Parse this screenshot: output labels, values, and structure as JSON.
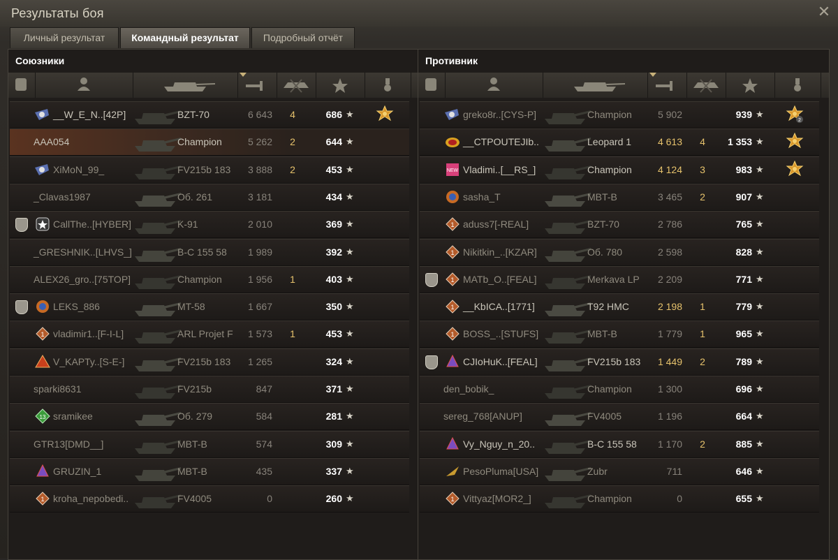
{
  "window": {
    "title": "Результаты боя",
    "close_icon": "close-icon"
  },
  "tabs": [
    {
      "label": "Личный результат",
      "active": false
    },
    {
      "label": "Командный результат",
      "active": true
    },
    {
      "label": "Подробный отчёт",
      "active": false
    }
  ],
  "columns": [
    "platoon-icon",
    "player-icon",
    "tank-icon",
    "damage-icon",
    "kills-icon",
    "xp-star-icon",
    "medal-icon"
  ],
  "allies": {
    "title": "Союзники",
    "rows": [
      {
        "name": "__W_E_N..[42P]",
        "vehicle": "BZT-70",
        "damage": "6 643",
        "kills": "4",
        "xp": "686",
        "badge": "rank",
        "medal": "ace",
        "platoon": false,
        "alive": true,
        "dmg_hi": false,
        "player": false
      },
      {
        "name": "AAA054",
        "vehicle": "Champion",
        "damage": "5 262",
        "kills": "2",
        "xp": "644",
        "badge": "",
        "medal": "",
        "platoon": false,
        "alive": false,
        "dmg_hi": false,
        "player": true
      },
      {
        "name": "XiMoN_99_",
        "vehicle": "FV215b 183",
        "damage": "3 888",
        "kills": "2",
        "xp": "453",
        "badge": "rank",
        "medal": "",
        "platoon": false,
        "alive": false,
        "dmg_hi": false,
        "player": false
      },
      {
        "name": "_Clavas1987",
        "vehicle": "Об. 261",
        "damage": "3 181",
        "kills": "",
        "xp": "434",
        "badge": "",
        "medal": "",
        "platoon": false,
        "alive": false,
        "dmg_hi": false,
        "player": false
      },
      {
        "name": "CallThe..[HYBER]",
        "vehicle": "K-91",
        "damage": "2 010",
        "kills": "",
        "xp": "369",
        "badge": "star",
        "medal": "",
        "platoon": true,
        "alive": false,
        "dmg_hi": false,
        "player": false
      },
      {
        "name": "_GRESHNIK..[LHVS_]",
        "vehicle": "В-С 155 58",
        "damage": "1 989",
        "kills": "",
        "xp": "392",
        "badge": "",
        "medal": "",
        "platoon": false,
        "alive": false,
        "dmg_hi": false,
        "player": false
      },
      {
        "name": "ALEX26_gro..[75TOP]",
        "vehicle": "Champion",
        "damage": "1 956",
        "kills": "1",
        "xp": "403",
        "badge": "",
        "medal": "",
        "platoon": false,
        "alive": false,
        "dmg_hi": false,
        "player": false
      },
      {
        "name": "LEKS_886",
        "vehicle": "MT-58",
        "damage": "1 667",
        "kills": "",
        "xp": "350",
        "badge": "gold",
        "medal": "",
        "platoon": true,
        "alive": false,
        "dmg_hi": false,
        "player": false
      },
      {
        "name": "vladimir1..[F-I-L]",
        "vehicle": "ARL Projet F",
        "damage": "1 573",
        "kills": "1",
        "xp": "453",
        "badge": "diamond",
        "medal": "",
        "platoon": false,
        "alive": false,
        "dmg_hi": false,
        "player": false
      },
      {
        "name": "V_KAPTy..[S-E-]",
        "vehicle": "FV215b 183",
        "damage": "1 265",
        "kills": "",
        "xp": "324",
        "badge": "triangle",
        "medal": "",
        "platoon": false,
        "alive": false,
        "dmg_hi": false,
        "player": false
      },
      {
        "name": "sparki8631",
        "vehicle": "FV215b",
        "damage": "847",
        "kills": "",
        "xp": "371",
        "badge": "",
        "medal": "",
        "platoon": false,
        "alive": false,
        "dmg_hi": false,
        "player": false
      },
      {
        "name": "sramikee",
        "vehicle": "Об. 279",
        "damage": "584",
        "kills": "",
        "xp": "281",
        "badge": "green",
        "medal": "",
        "platoon": false,
        "alive": false,
        "dmg_hi": false,
        "player": false
      },
      {
        "name": "GTR13[DMD__]",
        "vehicle": "MBT-B",
        "damage": "574",
        "kills": "",
        "xp": "309",
        "badge": "",
        "medal": "",
        "platoon": false,
        "alive": false,
        "dmg_hi": false,
        "player": false
      },
      {
        "name": "GRUZIN_1",
        "vehicle": "MBT-B",
        "damage": "435",
        "kills": "",
        "xp": "337",
        "badge": "purple",
        "medal": "",
        "platoon": false,
        "alive": false,
        "dmg_hi": false,
        "player": false
      },
      {
        "name": "kroha_nepobedi..",
        "vehicle": "FV4005",
        "damage": "0",
        "kills": "",
        "xp": "260",
        "badge": "diamond",
        "medal": "",
        "platoon": false,
        "alive": false,
        "dmg_hi": false,
        "player": false
      }
    ]
  },
  "enemies": {
    "title": "Противник",
    "rows": [
      {
        "name": "greko8r..[CYS-P]",
        "vehicle": "Champion",
        "damage": "5 902",
        "kills": "",
        "xp": "939",
        "badge": "rank",
        "medal": "ace2",
        "platoon": false,
        "alive": false,
        "dmg_hi": false,
        "player": false
      },
      {
        "name": "__CTPOUTEJIb..",
        "vehicle": "Leopard 1",
        "damage": "4 613",
        "kills": "4",
        "xp": "1 353",
        "badge": "gold-red",
        "medal": "ace",
        "platoon": false,
        "alive": true,
        "dmg_hi": true,
        "player": false
      },
      {
        "name": "Vladimi..[__RS_]",
        "vehicle": "Champion",
        "damage": "4 124",
        "kills": "3",
        "xp": "983",
        "badge": "pink",
        "medal": "ace",
        "platoon": false,
        "alive": true,
        "dmg_hi": true,
        "player": false
      },
      {
        "name": "sasha_T",
        "vehicle": "MBT-B",
        "damage": "3 465",
        "kills": "2",
        "xp": "907",
        "badge": "gold",
        "medal": "",
        "platoon": false,
        "alive": false,
        "dmg_hi": false,
        "player": false
      },
      {
        "name": "aduss7[-REAL]",
        "vehicle": "BZT-70",
        "damage": "2 786",
        "kills": "",
        "xp": "765",
        "badge": "diamond",
        "medal": "",
        "platoon": false,
        "alive": false,
        "dmg_hi": false,
        "player": false
      },
      {
        "name": "Nikitkin_..[KZAR]",
        "vehicle": "Об. 780",
        "damage": "2 598",
        "kills": "",
        "xp": "828",
        "badge": "diamond",
        "medal": "",
        "platoon": false,
        "alive": false,
        "dmg_hi": false,
        "player": false
      },
      {
        "name": "MATb_O..[FEAL]",
        "vehicle": "Merkava LP",
        "damage": "2 209",
        "kills": "",
        "xp": "771",
        "badge": "diamond",
        "medal": "",
        "platoon": true,
        "alive": false,
        "dmg_hi": false,
        "player": false
      },
      {
        "name": "__KbICA..[1771]",
        "vehicle": "T92 HMC",
        "damage": "2 198",
        "kills": "1",
        "xp": "779",
        "badge": "diamond",
        "medal": "",
        "platoon": false,
        "alive": true,
        "dmg_hi": true,
        "player": false
      },
      {
        "name": "BOSS_..[STUFS]",
        "vehicle": "MBT-B",
        "damage": "1 779",
        "kills": "1",
        "xp": "965",
        "badge": "diamond",
        "medal": "",
        "platoon": false,
        "alive": false,
        "dmg_hi": false,
        "player": false
      },
      {
        "name": "CJIoHuK..[FEAL]",
        "vehicle": "FV215b 183",
        "damage": "1 449",
        "kills": "2",
        "xp": "789",
        "badge": "purple",
        "medal": "",
        "platoon": true,
        "alive": true,
        "dmg_hi": true,
        "player": false
      },
      {
        "name": "den_bobik_",
        "vehicle": "Champion",
        "damage": "1 300",
        "kills": "",
        "xp": "696",
        "badge": "",
        "medal": "",
        "platoon": false,
        "alive": false,
        "dmg_hi": false,
        "player": false
      },
      {
        "name": "sereg_768[ANUP]",
        "vehicle": "FV4005",
        "damage": "1 196",
        "kills": "",
        "xp": "664",
        "badge": "",
        "medal": "",
        "platoon": false,
        "alive": false,
        "dmg_hi": false,
        "player": false
      },
      {
        "name": "Vy_Nguy_n_20..",
        "vehicle": "В-С 155 58",
        "damage": "1 170",
        "kills": "2",
        "xp": "885",
        "badge": "purple",
        "medal": "",
        "platoon": false,
        "alive": true,
        "dmg_hi": false,
        "player": false
      },
      {
        "name": "PesoPluma[USA]",
        "vehicle": "Zubr",
        "damage": "711",
        "kills": "",
        "xp": "646",
        "badge": "feather",
        "medal": "",
        "platoon": false,
        "alive": false,
        "dmg_hi": false,
        "player": false
      },
      {
        "name": "Vittyaz[MOR2_]",
        "vehicle": "Champion",
        "damage": "0",
        "kills": "",
        "xp": "655",
        "badge": "diamond",
        "medal": "",
        "platoon": false,
        "alive": false,
        "dmg_hi": false,
        "player": false
      }
    ]
  }
}
